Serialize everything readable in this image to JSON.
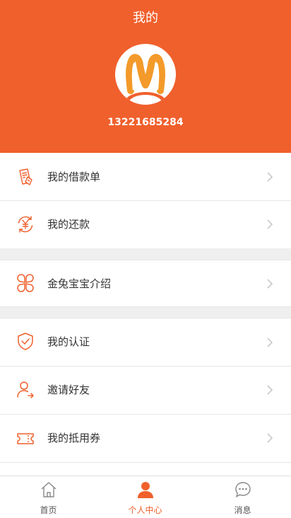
{
  "header": {
    "title": "我的",
    "phone": "13221685284"
  },
  "colors": {
    "accent": "#f0602c",
    "separator": "#efefef"
  },
  "menu": {
    "loans": {
      "label": "我的借款单",
      "icon": "document-icon"
    },
    "repay": {
      "label": "我的还款",
      "icon": "yuan-refresh-icon"
    },
    "intro": {
      "label": "金兔宝宝介绍",
      "icon": "clover-icon"
    },
    "verify": {
      "label": "我的认证",
      "icon": "shield-check-icon"
    },
    "invite": {
      "label": "邀请好友",
      "icon": "user-arrow-icon"
    },
    "coupon": {
      "label": "我的抵用券",
      "icon": "ticket-icon"
    }
  },
  "tabs": {
    "home": {
      "label": "首页",
      "icon": "home-icon"
    },
    "profile": {
      "label": "个人中心",
      "icon": "person-icon"
    },
    "messages": {
      "label": "消息",
      "icon": "chat-bubble-icon"
    }
  }
}
